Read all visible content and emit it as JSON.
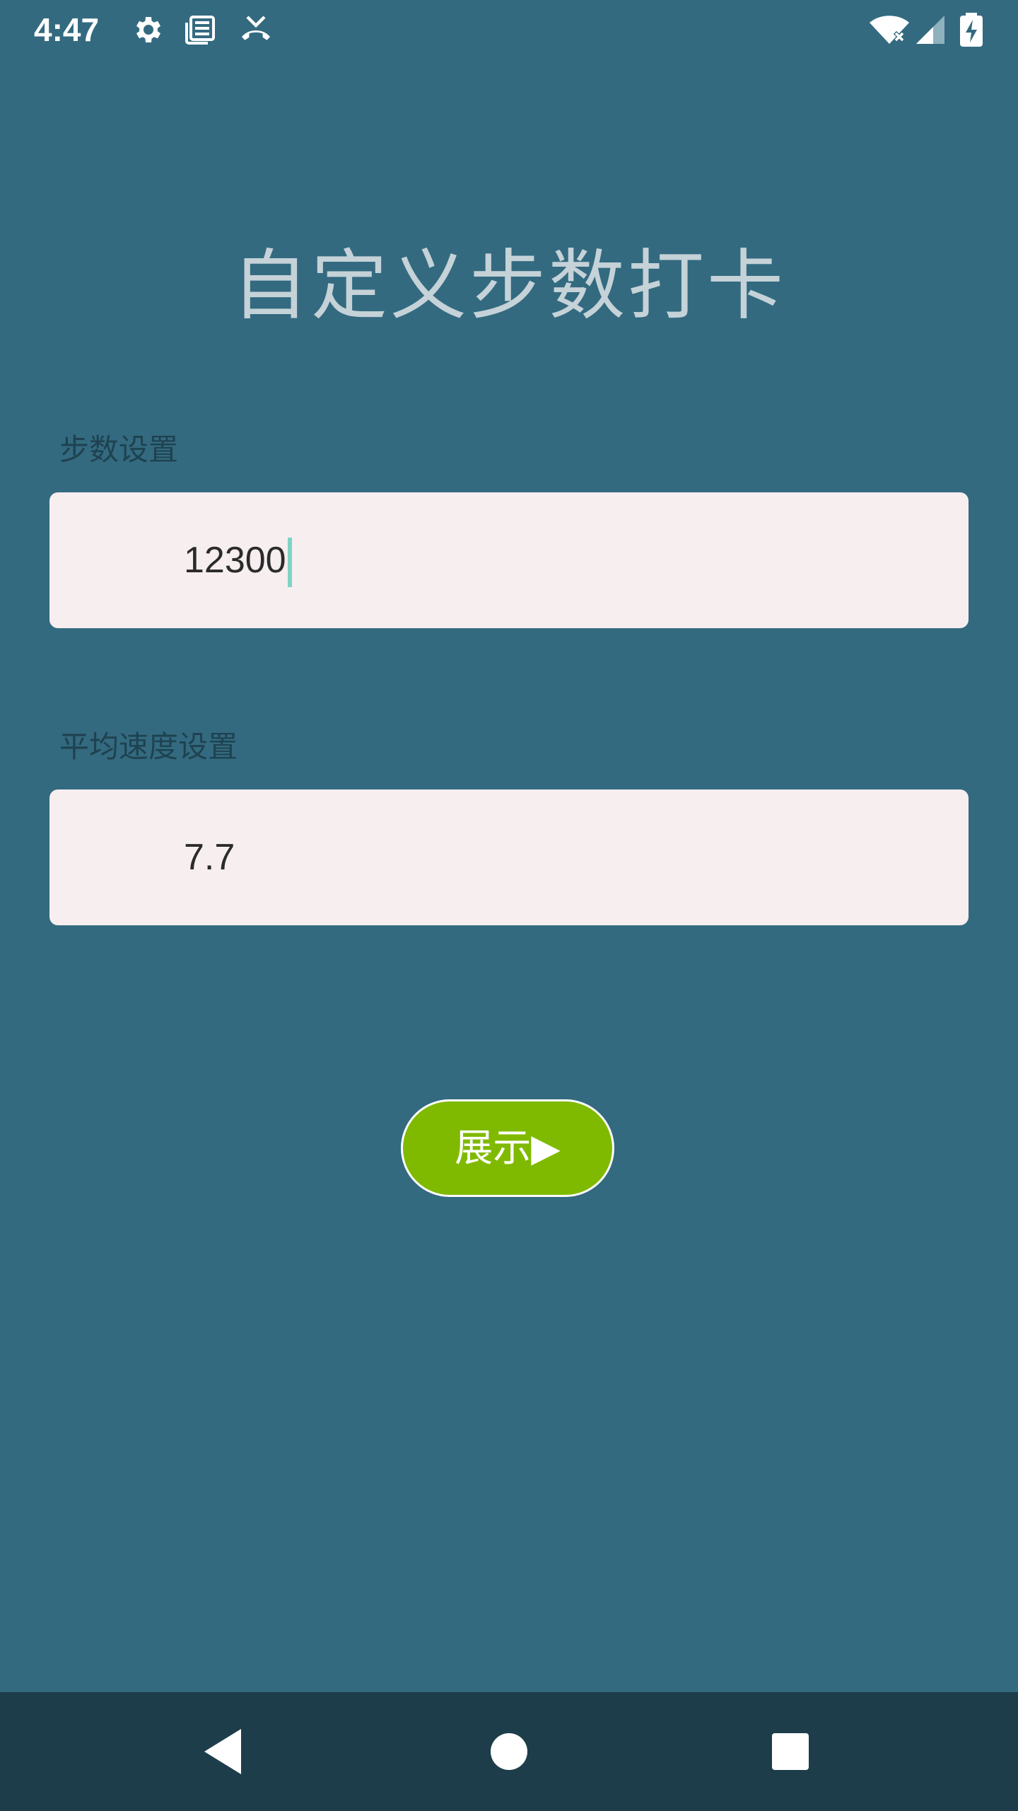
{
  "status_bar": {
    "time": "4:47",
    "icons": [
      "gear-icon",
      "news-icon",
      "missed-call-icon",
      "wifi-off-icon",
      "signal-icon",
      "battery-charging-icon"
    ]
  },
  "title": "自定义步数打卡",
  "steps_field": {
    "label": "步数设置",
    "value": "12300"
  },
  "speed_field": {
    "label": "平均速度设置",
    "value": "7.7"
  },
  "show_button": {
    "label": "展示▶"
  },
  "nav_bar": {
    "icons": [
      "back-icon",
      "home-icon",
      "recents-icon"
    ]
  },
  "colors": {
    "background": "#336a80",
    "title": "#c5d2d8",
    "field_bg": "#f7eef0",
    "button_bg": "#7fba00",
    "nav_bg": "#1d3d4a",
    "cursor": "#7fd3c4"
  }
}
